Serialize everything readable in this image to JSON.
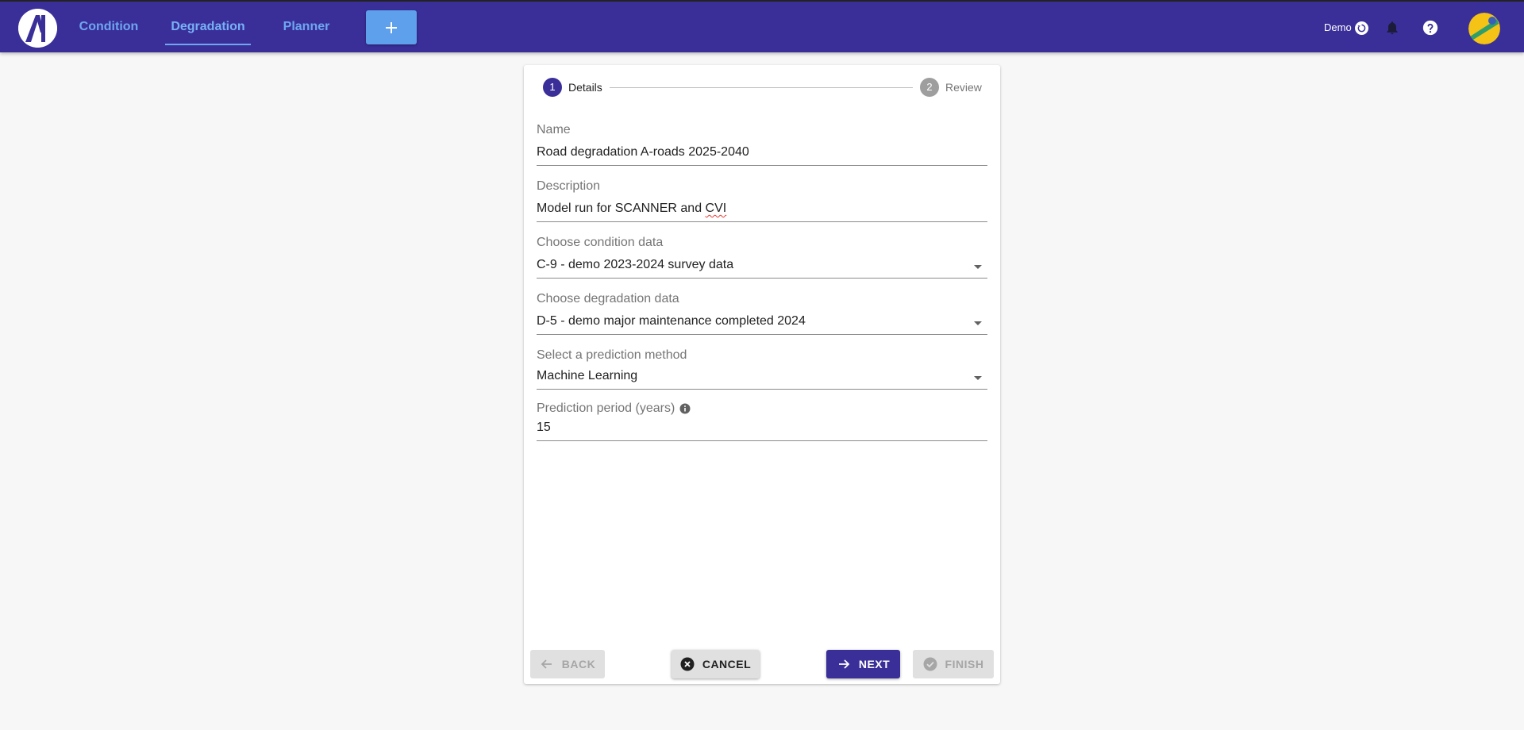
{
  "nav": {
    "tabs": [
      {
        "label": "Condition"
      },
      {
        "label": "Degradation",
        "active": true
      },
      {
        "label": "Planner"
      }
    ],
    "add_icon": "plus-icon"
  },
  "user": {
    "name": "Demo",
    "status_icon": "sync-icon",
    "notifications_icon": "bell-icon",
    "help_icon": "help-icon"
  },
  "stepper": {
    "steps": [
      {
        "number": "1",
        "label": "Details",
        "active": true
      },
      {
        "number": "2",
        "label": "Review",
        "active": false
      }
    ]
  },
  "form": {
    "name": {
      "label": "Name",
      "value": "Road degradation A-roads 2025-2040"
    },
    "description": {
      "label": "Description",
      "value_prefix": "Model run for SCANNER and ",
      "value_misspelled": "CVI"
    },
    "condition_data": {
      "label": "Choose condition data",
      "value": "C-9 - demo 2023-2024 survey data"
    },
    "degradation_data": {
      "label": "Choose degradation data",
      "value": "D-5 - demo major maintenance completed 2024"
    },
    "prediction_method": {
      "label": "Select a prediction method",
      "value": "Machine Learning"
    },
    "prediction_period": {
      "label": "Prediction period (years)",
      "value": "15"
    }
  },
  "buttons": {
    "back": "BACK",
    "cancel": "CANCEL",
    "next": "NEXT",
    "finish": "FINISH"
  },
  "colors": {
    "primary": "#3a2f99",
    "nav_link": "#6fa6f0",
    "add_button": "#5ea0ec",
    "background": "#f7f7f7"
  }
}
